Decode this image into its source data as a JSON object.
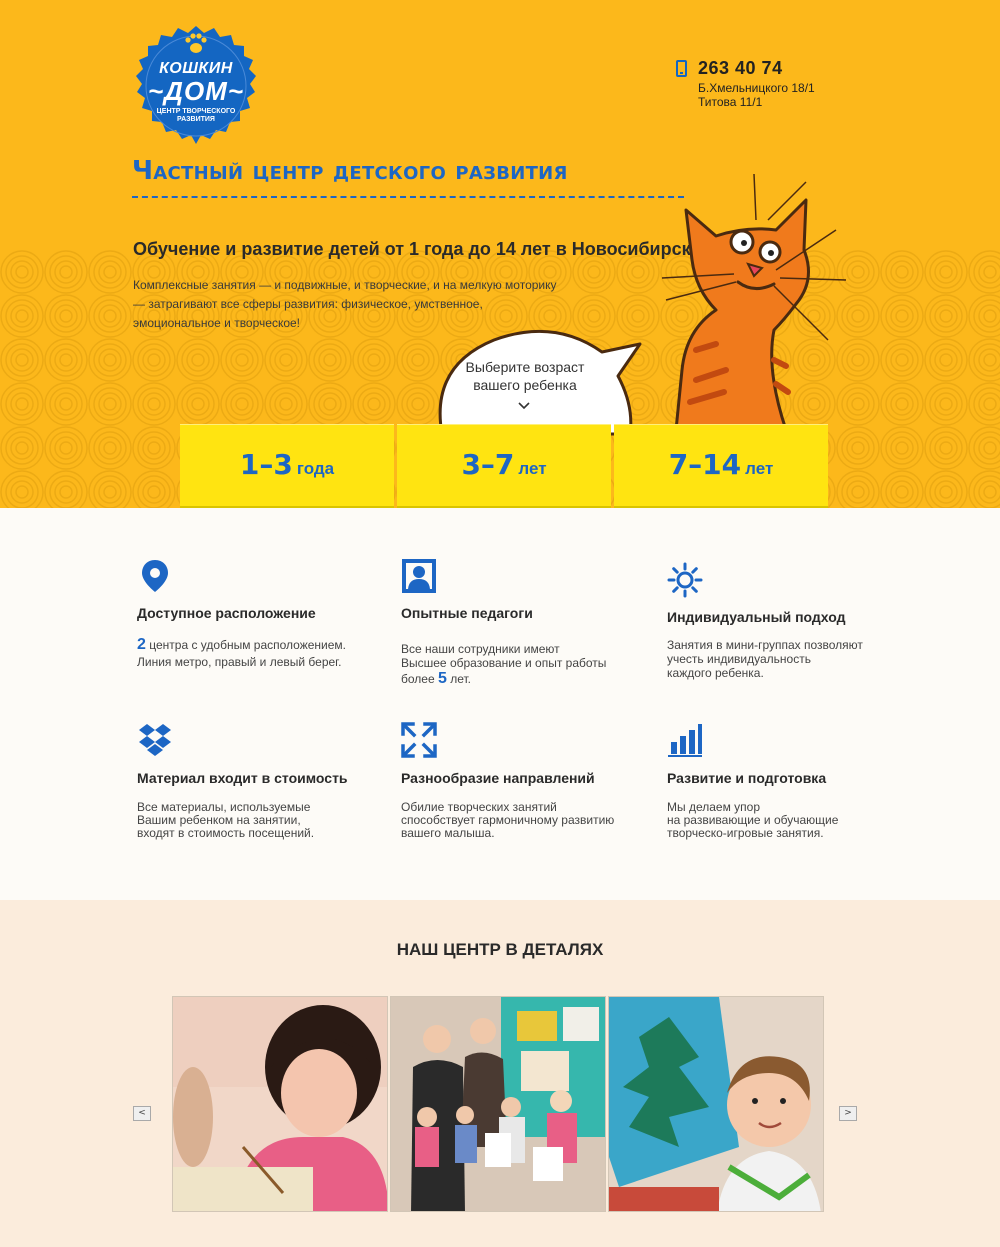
{
  "logo": {
    "name_top": "КОШКИН",
    "name_bottom": "~ДОМ~",
    "subtitle": "центр творческого развития"
  },
  "contact": {
    "phone": "263 40 74",
    "address1": "Б.Хмельницкого 18/1",
    "address2": "Титова 11/1"
  },
  "hero": {
    "title": "Частный центр детского развития",
    "lead": "Обучение и развитие детей от 1 года до 14 лет в Новосибирске.",
    "description_lines": [
      "Комплексные занятия — и подвижные, и творческие, и на мелкую моторику",
      "— затрагивают все сферы развития: физическое, умственное,",
      "эмоциональное и творческое!"
    ],
    "bubble_lines": [
      "Выберите возраст",
      "вашего ребенка"
    ]
  },
  "age_groups": [
    {
      "range": "1–3",
      "unit": "года"
    },
    {
      "range": "3–7",
      "unit": "лет"
    },
    {
      "range": "7–14",
      "unit": "лет"
    }
  ],
  "features": {
    "location": {
      "title": "Доступное расположение",
      "count": "2",
      "line1_rest": " центра с удобным расположением.",
      "line2": "Линия метро, правый и левый берег."
    },
    "teachers": {
      "title": "Опытные педагоги",
      "line1": "Все наши сотрудники имеют",
      "line2": "Высшее образование и опыт работы",
      "line3_pre": "более ",
      "years": "5",
      "line3_post": " лет."
    },
    "individual": {
      "title": "Индивидуальный подход",
      "lines": [
        "Занятия в мини-группах позволяют",
        "учесть индивидуальность",
        "каждого ребенка."
      ]
    },
    "materials": {
      "title": "Материал входит в стоимость",
      "lines": [
        "Все материалы, используемые",
        "Вашим ребенком на занятии,",
        "входят в стоимость посещений."
      ]
    },
    "variety": {
      "title": "Разнообразие направлений",
      "lines": [
        "Обилие творческих занятий",
        "способствует гармоничному развитию",
        "вашего малыша."
      ]
    },
    "development": {
      "title": "Развитие и подготовка",
      "lines": [
        "Мы делаем упор",
        "на развивающие и обучающие",
        "творческо-игровые занятия."
      ]
    }
  },
  "details": {
    "title": "Наш центр в деталях",
    "prev_label": "<",
    "next_label": ">"
  },
  "colors": {
    "hero_bg": "#fcb81b",
    "accent_blue": "#1d66c4",
    "age_button": "#ffe411",
    "details_bg": "#fbecdc"
  }
}
